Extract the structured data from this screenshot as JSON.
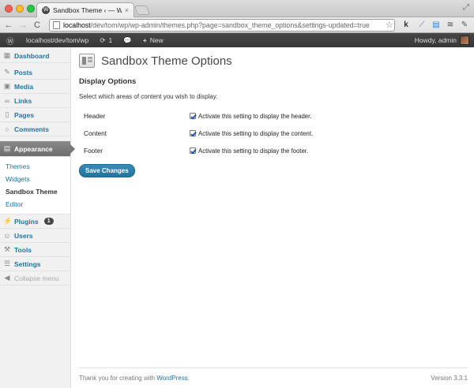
{
  "browser": {
    "tab_title": "Sandbox Theme ‹ — WordPress",
    "url_host": "localhost",
    "url_path": "/dev/tom/wp/wp-admin/themes.php?page=sandbox_theme_options&settings-updated=true"
  },
  "adminbar": {
    "site": "localhost/dev/tom/wp",
    "updates": "1",
    "new_label": "New",
    "howdy": "Howdy, admin"
  },
  "sidebar": {
    "items": [
      {
        "label": "Dashboard",
        "icon": "dashboard-icon"
      },
      {
        "label": "Posts",
        "icon": "pin-icon"
      },
      {
        "label": "Media",
        "icon": "media-icon"
      },
      {
        "label": "Links",
        "icon": "link-icon"
      },
      {
        "label": "Pages",
        "icon": "page-icon"
      },
      {
        "label": "Comments",
        "icon": "comment-icon"
      },
      {
        "label": "Appearance",
        "icon": "appearance-icon"
      }
    ],
    "appearance_sub": [
      "Themes",
      "Widgets",
      "Sandbox Theme",
      "Editor"
    ],
    "plugins": "Plugins",
    "plugins_badge": "1",
    "users": "Users",
    "tools": "Tools",
    "settings": "Settings",
    "collapse": "Collapse menu"
  },
  "main": {
    "title": "Sandbox Theme Options",
    "section_title": "Display Options",
    "description": "Select which areas of content you wish to display.",
    "options": [
      {
        "label": "Header",
        "text": "Activate this setting to display the header.",
        "checked": true
      },
      {
        "label": "Content",
        "text": "Activate this setting to display the content.",
        "checked": true
      },
      {
        "label": "Footer",
        "text": "Activate this setting to display the footer.",
        "checked": true
      }
    ],
    "save_label": "Save Changes"
  },
  "footer": {
    "thanks_prefix": "Thank you for creating with ",
    "wp_link": "WordPress",
    "thanks_suffix": ".",
    "version": "Version 3.3.1"
  },
  "colors": {
    "accent": "#21759b",
    "adminbar": "#464646"
  }
}
